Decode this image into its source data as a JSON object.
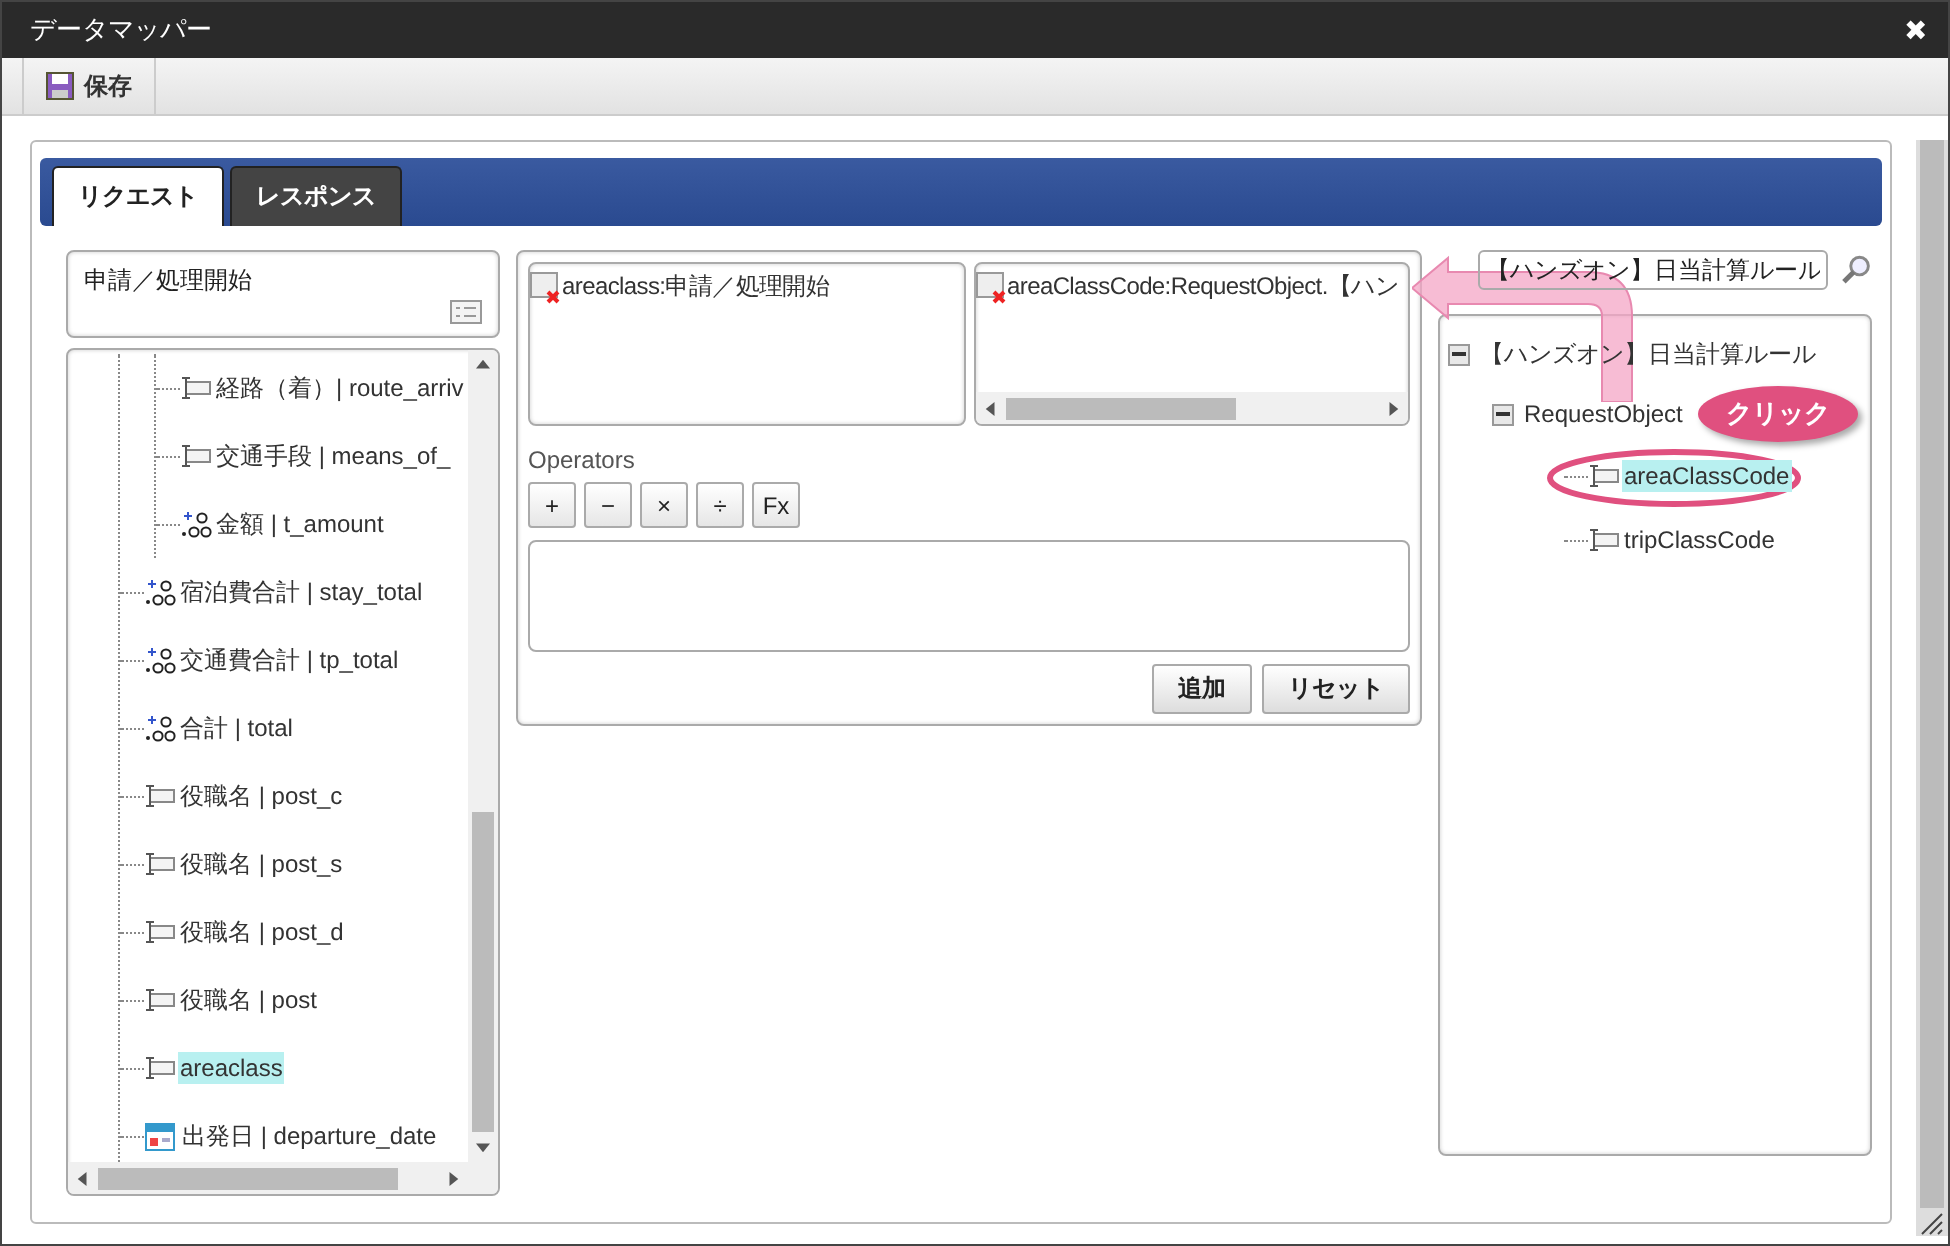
{
  "window": {
    "title": "データマッパー",
    "close": "✖"
  },
  "toolbar": {
    "save": "保存"
  },
  "tabs": [
    {
      "label": "リクエスト",
      "selected": true
    },
    {
      "label": "レスポンス",
      "selected": false
    }
  ],
  "source": {
    "title": "申請／処理開始",
    "items": [
      {
        "kind": "group",
        "children": [
          {
            "kind": "text",
            "label": "経路（着）| route_arriv",
            "selected": false
          },
          {
            "kind": "text",
            "label": "交通手段 | means_of_",
            "selected": false
          },
          {
            "kind": "number",
            "label": "金額 | t_amount",
            "selected": false
          }
        ]
      },
      {
        "kind": "number",
        "label": "宿泊費合計 | stay_total",
        "selected": false
      },
      {
        "kind": "number",
        "label": "交通費合計 | tp_total",
        "selected": false
      },
      {
        "kind": "number",
        "label": "合計 | total",
        "selected": false
      },
      {
        "kind": "text",
        "label": "役職名 | post_c",
        "selected": false
      },
      {
        "kind": "text",
        "label": "役職名 | post_s",
        "selected": false
      },
      {
        "kind": "text",
        "label": "役職名 | post_d",
        "selected": false
      },
      {
        "kind": "text",
        "label": "役職名 | post",
        "selected": false
      },
      {
        "kind": "text",
        "label": "areaclass",
        "selected": true
      },
      {
        "kind": "date",
        "label": "出発日 | departure_date",
        "selected": false
      }
    ]
  },
  "mapping": {
    "source_item": "areaclass:申請／処理開始",
    "target_item": "areaClassCode:RequestObject.【ハン",
    "operators_label": "Operators",
    "operators": [
      "+",
      "−",
      "×",
      "÷",
      "Fx"
    ],
    "buttons": [
      "追加",
      "リセット"
    ]
  },
  "target": {
    "search": {
      "value": "【ハンズオン】日当計算ルール"
    },
    "items": [
      {
        "label": "【ハンズオン】日当計算ルール",
        "expanded": true,
        "children": [
          {
            "label": "RequestObject",
            "expanded": true,
            "children": [
              {
                "label": "areaClassCode",
                "selected": true
              },
              {
                "label": "tripClassCode",
                "selected": false
              }
            ]
          }
        ]
      }
    ]
  },
  "callout": {
    "text": "クリック"
  }
}
